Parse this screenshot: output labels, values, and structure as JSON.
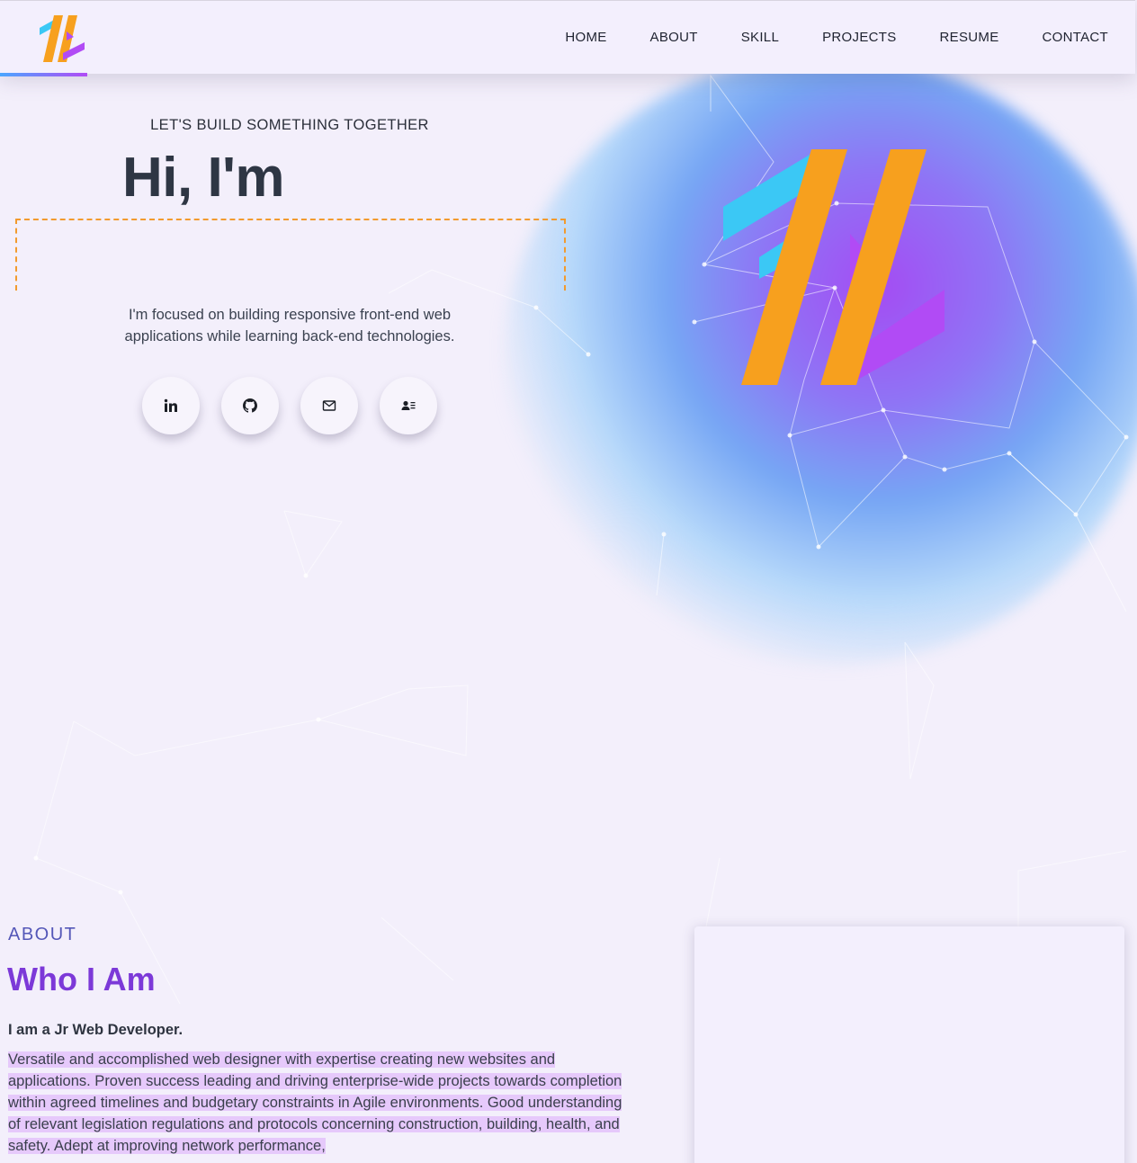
{
  "header": {
    "logo_name": "logo-icon",
    "nav": [
      {
        "label": "HOME"
      },
      {
        "label": "ABOUT"
      },
      {
        "label": "SKILL"
      },
      {
        "label": "PROJECTS"
      },
      {
        "label": "RESUME"
      },
      {
        "label": "CONTACT"
      }
    ]
  },
  "hero": {
    "tagline": "LET'S BUILD SOMETHING TOGETHER",
    "greeting": "Hi, I'm",
    "typed_text": "",
    "description": "I'm focused on building responsive front-end web applications while learning back-end technologies.",
    "socials": [
      {
        "icon": "linkedin-icon"
      },
      {
        "icon": "github-icon"
      },
      {
        "icon": "mail-icon"
      },
      {
        "icon": "contact-card-icon"
      }
    ]
  },
  "about": {
    "kicker": "ABOUT",
    "title": "Who I Am",
    "subtitle": "I am a Jr Web Developer.",
    "body": "Versatile and accomplished web designer with expertise creating new websites and applications. Proven success leading and driving enterprise-wide projects towards completion within agreed timelines and budgetary constraints in Agile environments. Good understanding of relevant legislation regulations and protocols concerning construction, building, health, and safety. Adept at improving network performance,"
  },
  "colors": {
    "accent_orange": "#f7a01e",
    "accent_purple": "#b14bf5",
    "accent_blue": "#3bc8f5",
    "title_purple": "#7c39d8"
  }
}
